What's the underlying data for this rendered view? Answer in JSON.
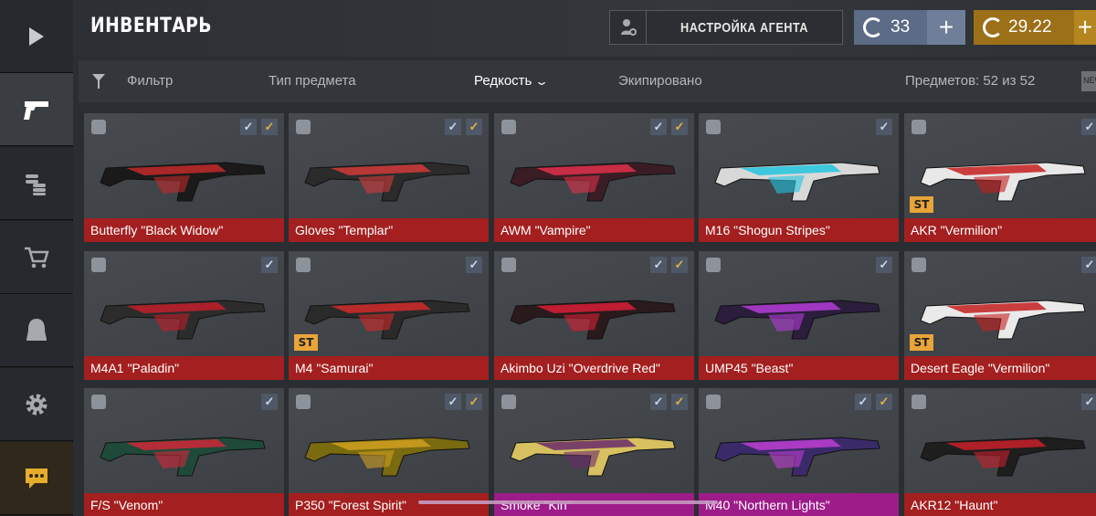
{
  "header": {
    "title": "ИНВЕНТАРЬ",
    "agent_button": "НАСТРОЙКА АГЕНТА",
    "silver_amount": "33",
    "gold_amount": "29.22",
    "plus": "+"
  },
  "filters": {
    "filter": "Фильтр",
    "item_type": "Тип предмета",
    "rarity": "Редкость",
    "equipped": "Экипировано",
    "count": "Предметов: 52 из 52",
    "new_badge": "NEW"
  },
  "sidebar": {
    "items": [
      "play-icon",
      "pistol-icon",
      "coins-icon",
      "cart-icon",
      "agent-icon",
      "gear-icon",
      "chat-icon"
    ]
  },
  "cards": [
    {
      "name": "Butterfly \"Black Widow\"",
      "rarity_color": "red",
      "blue_check": true,
      "gold_check": true,
      "st": false
    },
    {
      "name": "Gloves \"Templar\"",
      "rarity_color": "red",
      "blue_check": true,
      "gold_check": true,
      "st": false
    },
    {
      "name": "AWM \"Vampire\"",
      "rarity_color": "red",
      "blue_check": true,
      "gold_check": true,
      "st": false
    },
    {
      "name": "M16 \"Shogun Stripes\"",
      "rarity_color": "red",
      "blue_check": true,
      "gold_check": false,
      "st": false
    },
    {
      "name": "AKR \"Vermilion\"",
      "rarity_color": "red",
      "blue_check": true,
      "gold_check": false,
      "st": true
    },
    {
      "name": "M4A1 \"Paladin\"",
      "rarity_color": "red",
      "blue_check": true,
      "gold_check": false,
      "st": false
    },
    {
      "name": "M4 \"Samurai\"",
      "rarity_color": "red",
      "blue_check": true,
      "gold_check": false,
      "st": true
    },
    {
      "name": "Akimbo Uzi \"Overdrive Red\"",
      "rarity_color": "red",
      "blue_check": true,
      "gold_check": true,
      "st": false
    },
    {
      "name": "UMP45 \"Beast\"",
      "rarity_color": "red",
      "blue_check": true,
      "gold_check": false,
      "st": false
    },
    {
      "name": "Desert Eagle \"Vermilion\"",
      "rarity_color": "red",
      "blue_check": true,
      "gold_check": false,
      "st": true
    },
    {
      "name": "F/S \"Venom\"",
      "rarity_color": "red",
      "blue_check": true,
      "gold_check": false,
      "st": false
    },
    {
      "name": "P350 \"Forest Spirit\"",
      "rarity_color": "red",
      "blue_check": true,
      "gold_check": true,
      "st": false
    },
    {
      "name": "Smoke \"Kin\"",
      "rarity_color": "pink",
      "blue_check": true,
      "gold_check": true,
      "st": false
    },
    {
      "name": "M40 \"Northern Lights\"",
      "rarity_color": "pink",
      "blue_check": true,
      "gold_check": true,
      "st": false
    },
    {
      "name": "AKR12 \"Haunt\"",
      "rarity_color": "red",
      "blue_check": true,
      "gold_check": false,
      "st": false
    }
  ],
  "st_label": "ST",
  "colors": {
    "rarity_red": "#a41f1f",
    "rarity_pink": "#9e1c8a",
    "silver": "#5c6b86",
    "gold": "#9c7018",
    "st_badge": "#e9a43a"
  }
}
